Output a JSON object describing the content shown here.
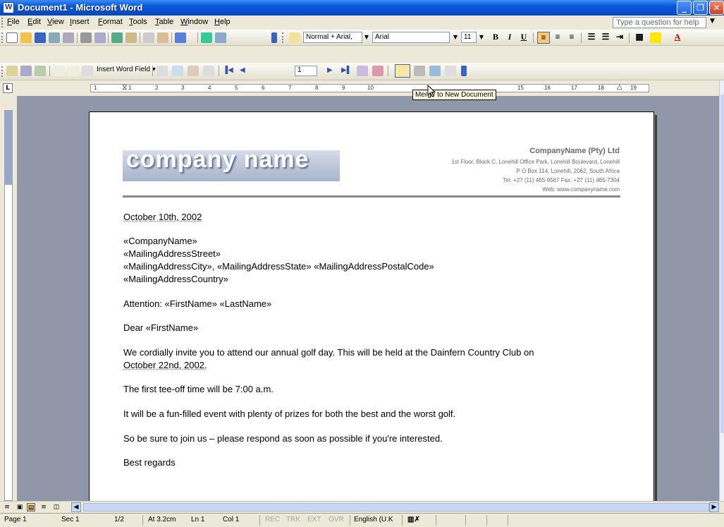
{
  "window": {
    "title": "Document1 - Microsoft Word",
    "minimize": "_",
    "maximize": "❐",
    "close": "✕"
  },
  "menu": {
    "items": [
      "File",
      "Edit",
      "View",
      "Insert",
      "Format",
      "Tools",
      "Table",
      "Window",
      "Help"
    ],
    "help_placeholder": "Type a question for help"
  },
  "formatting": {
    "style": "Normal + Arial,",
    "font": "Arial",
    "size": "11",
    "bold": "B",
    "italic": "I",
    "underline": "U",
    "align_left_active": true
  },
  "mail_merge_toolbar": {
    "insert_word_field": "Insert Word Field",
    "record": "1",
    "tooltip": "Merge to New Document"
  },
  "ruler": {
    "ticks": [
      "1",
      "1",
      "2",
      "3",
      "4",
      "5",
      "6",
      "7",
      "8",
      "9",
      "10",
      "15",
      "16",
      "17",
      "18",
      "19"
    ]
  },
  "letterhead": {
    "logo_text": "company name",
    "company": "CompanyName (Pty) Ltd",
    "address_line1": "1st Floor, Block C, Lonehill Office Park, Lonehill Boulevard, Lonehill",
    "address_line2": "P O Box 114, Lonehill, 2062, South Africa",
    "phone_line": "Tel: +27 (11) 465-9567  Fax: +27 (11) 465-7304",
    "web_line": "Web:  www.companyname.com"
  },
  "letter": {
    "date": "October 10th, 2002",
    "merge_company": "«CompanyName»",
    "merge_street": "«MailingAddressStreet»",
    "merge_city_line": "«MailingAddressCity», «MailingAddressState» «MailingAddressPostalCode»",
    "merge_country": "«MailingAddressCountry»",
    "attention": "Attention: «FirstName» «LastName»",
    "greeting": "Dear «FirstName»",
    "para1_line1": "We cordially invite you to attend our annual golf day. This will be held at the Dainfern Country Club on",
    "para1_line2": "October 22nd, 2002.",
    "para2": "The first tee-off time will be 7:00 a.m.",
    "para3": "It will be a fun-filled event with plenty of prizes for both the best and the worst golf.",
    "para4": "So be sure to join us – please respond as soon as possible if you're interested.",
    "closing": "Best regards"
  },
  "status": {
    "page": "Page 1",
    "section": "Sec 1",
    "page_count": "1/2",
    "at": "At 3.2cm",
    "line": "Ln 1",
    "col": "Col 1",
    "rec": "REC",
    "trk": "TRK",
    "ext": "EXT",
    "ovr": "OVR",
    "language": "English (U.K"
  },
  "colors": {
    "titlebar": "#0a58d8",
    "workspace": "#8f97a9",
    "accent_active": "#ffc869"
  }
}
